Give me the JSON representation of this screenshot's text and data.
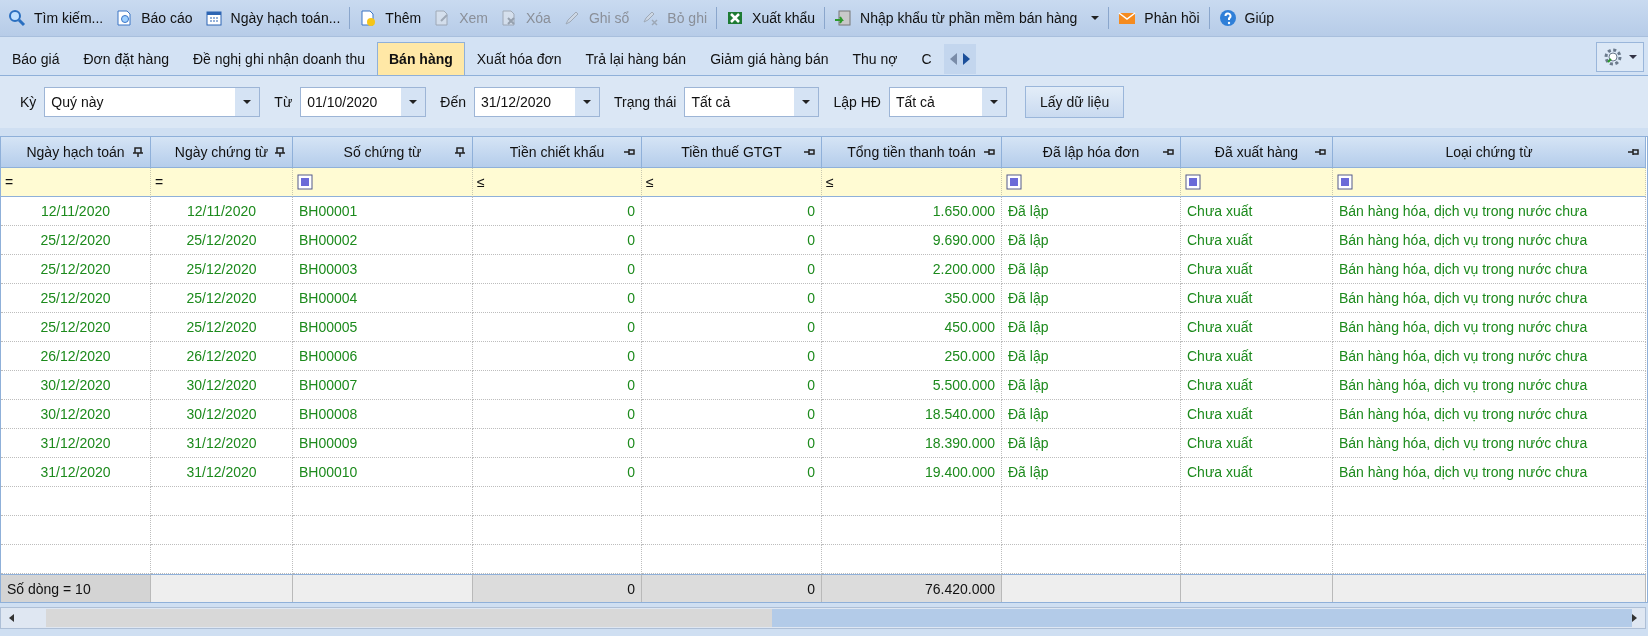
{
  "toolbar": [
    {
      "kind": "button",
      "label": "Tìm kiếm...",
      "disabled": false
    },
    {
      "kind": "button",
      "label": "Báo cáo",
      "disabled": false
    },
    {
      "kind": "button",
      "label": "Ngày hạch toán...",
      "disabled": false
    },
    {
      "kind": "separator"
    },
    {
      "kind": "button",
      "label": "Thêm",
      "disabled": false
    },
    {
      "kind": "button",
      "label": "Xem",
      "disabled": true
    },
    {
      "kind": "button",
      "label": "Xóa",
      "disabled": true
    },
    {
      "kind": "button",
      "label": "Ghi sổ",
      "disabled": true
    },
    {
      "kind": "button",
      "label": "Bỏ ghi",
      "disabled": true
    },
    {
      "kind": "separator"
    },
    {
      "kind": "button",
      "label": "Xuất khẩu",
      "disabled": false
    },
    {
      "kind": "separator"
    },
    {
      "kind": "dropdown",
      "label": "Nhập khẩu từ phần mềm bán hàng",
      "disabled": false
    },
    {
      "kind": "separator"
    },
    {
      "kind": "button",
      "label": "Phản hồi",
      "disabled": false
    },
    {
      "kind": "separator"
    },
    {
      "kind": "button",
      "label": "Giúp",
      "disabled": false
    }
  ],
  "tabs": [
    {
      "label": "Báo giá",
      "selected": false
    },
    {
      "label": "Đơn đặt hàng",
      "selected": false
    },
    {
      "label": "Đề nghị ghi nhận doanh thu",
      "selected": false
    },
    {
      "label": "Bán hàng",
      "selected": true
    },
    {
      "label": "Xuất hóa đơn",
      "selected": false
    },
    {
      "label": "Trả lại hàng bán",
      "selected": false
    },
    {
      "label": "Giảm giá hàng bán",
      "selected": false
    },
    {
      "label": "Thu nợ",
      "selected": false
    },
    {
      "label": "C",
      "selected": false
    }
  ],
  "filters": [
    {
      "label": "Kỳ",
      "value": "Quý này",
      "kind": "wide"
    },
    {
      "label": "Từ",
      "value": "01/10/2020",
      "kind": "date"
    },
    {
      "label": "Đến",
      "value": "31/12/2020",
      "kind": "date"
    },
    {
      "label": "Trạng thái",
      "value": "Tất cả",
      "kind": "medium"
    },
    {
      "label": "Lập HĐ",
      "value": "Tất cả",
      "kind": "short"
    }
  ],
  "fetch_button": "Lấy dữ liệu",
  "table": {
    "columns": [
      {
        "label": "Ngày hạch toán",
        "pinned": true,
        "filter": {
          "kind": "operator",
          "symbol": "="
        }
      },
      {
        "label": "Ngày chứng từ",
        "pinned": true,
        "filter": {
          "kind": "operator",
          "symbol": "="
        }
      },
      {
        "label": "Số chứng từ",
        "pinned": true,
        "filter": {
          "kind": "checkbox"
        }
      },
      {
        "label": "Tiền chiết khấu",
        "pinned": false,
        "filter": {
          "kind": "operator",
          "symbol": "≤"
        },
        "total": "0"
      },
      {
        "label": "Tiền thuế GTGT",
        "pinned": false,
        "filter": {
          "kind": "operator",
          "symbol": "≤"
        },
        "total": "0"
      },
      {
        "label": "Tổng tiền thanh toán",
        "pinned": false,
        "filter": {
          "kind": "operator",
          "symbol": "≤"
        },
        "total": "76.420.000"
      },
      {
        "label": "Đã lập hóa đơn",
        "pinned": false,
        "filter": {
          "kind": "checkbox"
        }
      },
      {
        "label": "Đã xuất hàng",
        "pinned": false,
        "filter": {
          "kind": "checkbox"
        }
      },
      {
        "label": "Loại chứng từ",
        "pinned": false,
        "filter": {
          "kind": "checkbox"
        }
      }
    ],
    "rows": [
      [
        "12/11/2020",
        "12/11/2020",
        "BH00001",
        "0",
        "0",
        "1.650.000",
        "Đã lập",
        "Chưa xuất",
        "Bán hàng hóa, dịch vụ trong nước chưa"
      ],
      [
        "25/12/2020",
        "25/12/2020",
        "BH00002",
        "0",
        "0",
        "9.690.000",
        "Đã lập",
        "Chưa xuất",
        "Bán hàng hóa, dịch vụ trong nước chưa"
      ],
      [
        "25/12/2020",
        "25/12/2020",
        "BH00003",
        "0",
        "0",
        "2.200.000",
        "Đã lập",
        "Chưa xuất",
        "Bán hàng hóa, dịch vụ trong nước chưa"
      ],
      [
        "25/12/2020",
        "25/12/2020",
        "BH00004",
        "0",
        "0",
        "350.000",
        "Đã lập",
        "Chưa xuất",
        "Bán hàng hóa, dịch vụ trong nước chưa"
      ],
      [
        "25/12/2020",
        "25/12/2020",
        "BH00005",
        "0",
        "0",
        "450.000",
        "Đã lập",
        "Chưa xuất",
        "Bán hàng hóa, dịch vụ trong nước chưa"
      ],
      [
        "26/12/2020",
        "26/12/2020",
        "BH00006",
        "0",
        "0",
        "250.000",
        "Đã lập",
        "Chưa xuất",
        "Bán hàng hóa, dịch vụ trong nước chưa"
      ],
      [
        "30/12/2020",
        "30/12/2020",
        "BH00007",
        "0",
        "0",
        "5.500.000",
        "Đã lập",
        "Chưa xuất",
        "Bán hàng hóa, dịch vụ trong nước chưa"
      ],
      [
        "30/12/2020",
        "30/12/2020",
        "BH00008",
        "0",
        "0",
        "18.540.000",
        "Đã lập",
        "Chưa xuất",
        "Bán hàng hóa, dịch vụ trong nước chưa"
      ],
      [
        "31/12/2020",
        "31/12/2020",
        "BH00009",
        "0",
        "0",
        "18.390.000",
        "Đã lập",
        "Chưa xuất",
        "Bán hàng hóa, dịch vụ trong nước chưa"
      ],
      [
        "31/12/2020",
        "31/12/2020",
        "BH00010",
        "0",
        "0",
        "19.400.000",
        "Đã lập",
        "Chưa xuất",
        "Bán hàng hóa, dịch vụ trong nước chưa"
      ]
    ],
    "row_count": "Số dòng = 10"
  }
}
